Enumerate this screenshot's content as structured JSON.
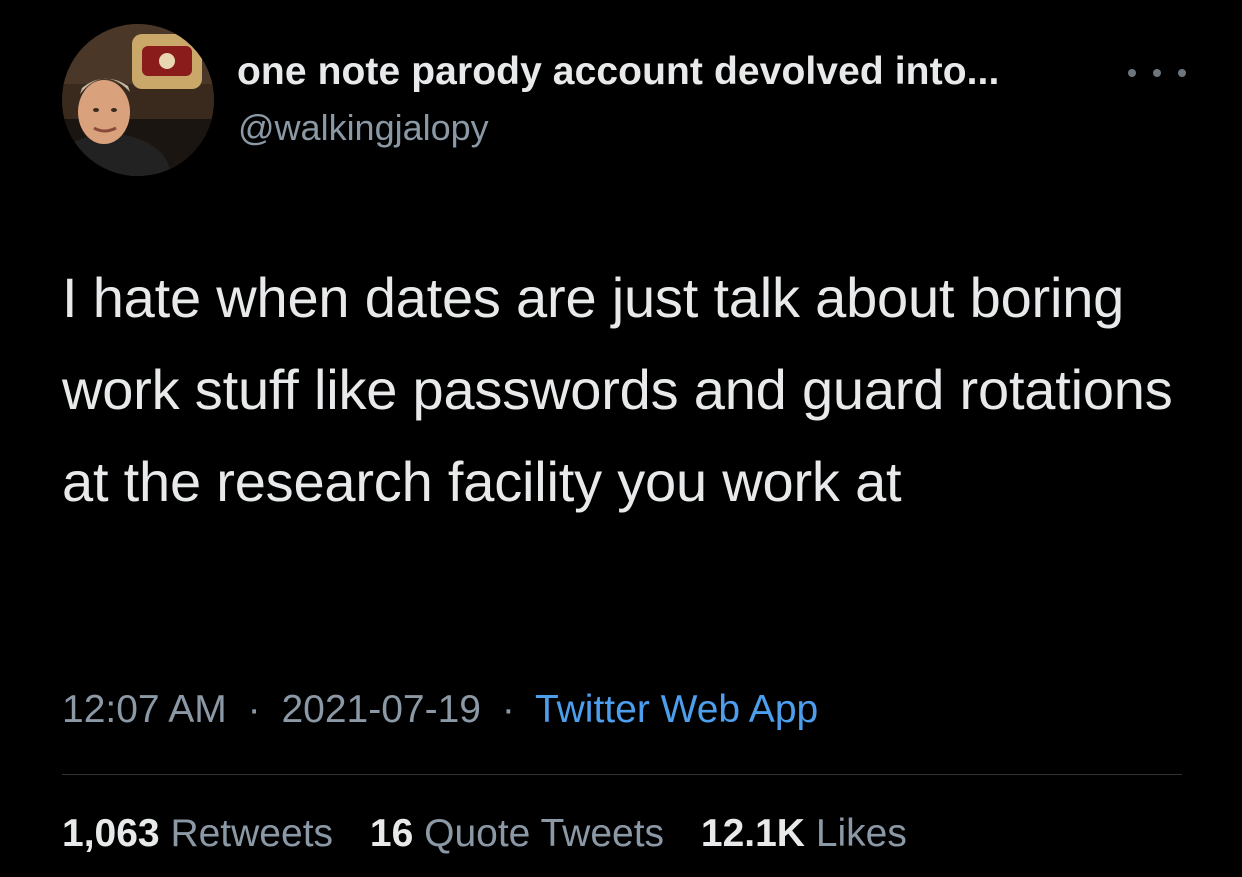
{
  "tweet": {
    "author": {
      "display_name": "one note parody account devolved into...",
      "handle": "@walkingjalopy"
    },
    "text": "I hate when dates are just talk about boring work stuff like passwords and guard rotations at the research facility you work at",
    "time": "12:07 AM",
    "separator": "·",
    "date": "2021-07-19",
    "source": "Twitter Web App",
    "stats": {
      "retweets_count": "1,063",
      "retweets_label": "Retweets",
      "quotes_count": "16",
      "quotes_label": "Quote Tweets",
      "likes_count": "12.1K",
      "likes_label": "Likes"
    }
  },
  "icons": {
    "more": "more-horizontal-icon"
  },
  "colors": {
    "background": "#000000",
    "primary_text": "#e7e9ea",
    "secondary_text": "#8b98a5",
    "link": "#4d9eec",
    "divider": "#2f3336"
  }
}
